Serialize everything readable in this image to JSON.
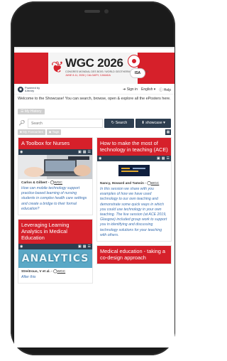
{
  "banner": {
    "title": "WGC 2026",
    "subline1": "CONGRES MONDIAL DES BOIS / WORLD GEOTHERMAL CONGRESS",
    "subline2": "JUNE 8-11, 2026 | CALGARY, CANADA",
    "partner_label": "ISA"
  },
  "topbar": {
    "brand_line1": "Powered by",
    "brand_line2": "iLibrary",
    "signin": "Sign in",
    "language": "English",
    "help": "Help"
  },
  "welcome_text": "Welcome to the Showcase! You can search, browse, open & explore all the ePosters here.",
  "history_button": "My History",
  "search": {
    "placeholder": "Search",
    "search_button": "Search",
    "showcase_button": "showcase"
  },
  "filters": {
    "favourites": "My Favourites",
    "tags": "Tags"
  },
  "cards_left": [
    {
      "title": "A Toolbox for Nurses",
      "author": "Carlos & Gilbert",
      "wgc": "WGC",
      "description": "How can mobile technology support practice-based learning of nursing students in complex health care settings and create a bridge to their formal education?"
    },
    {
      "title": "Leveraging Learning Analytics in Medical Education",
      "author": "Streitrous, V et al.",
      "wgc": "WGC",
      "image_text": "ANALYTICS",
      "description": "After this"
    }
  ],
  "cards_right": [
    {
      "title": "How to make the most of technology in teaching (ACE)",
      "author": "Nancy, Howard and Tamsin",
      "wgc": "WGC",
      "description": "In this session we share with you examples of how we have used technology to our own teaching and demonstrate some quick ways in which you could use technology in your own teaching. The live session (at ACE 2019, Glasgow) included group work to support you in identifying and discussing technology solutions for your teaching with others."
    },
    {
      "title": "Medical education - taking a co-design approach"
    }
  ],
  "colors": {
    "accent_red": "#d6202a",
    "navy": "#2d3e50",
    "link_blue": "#3a6fb0"
  }
}
